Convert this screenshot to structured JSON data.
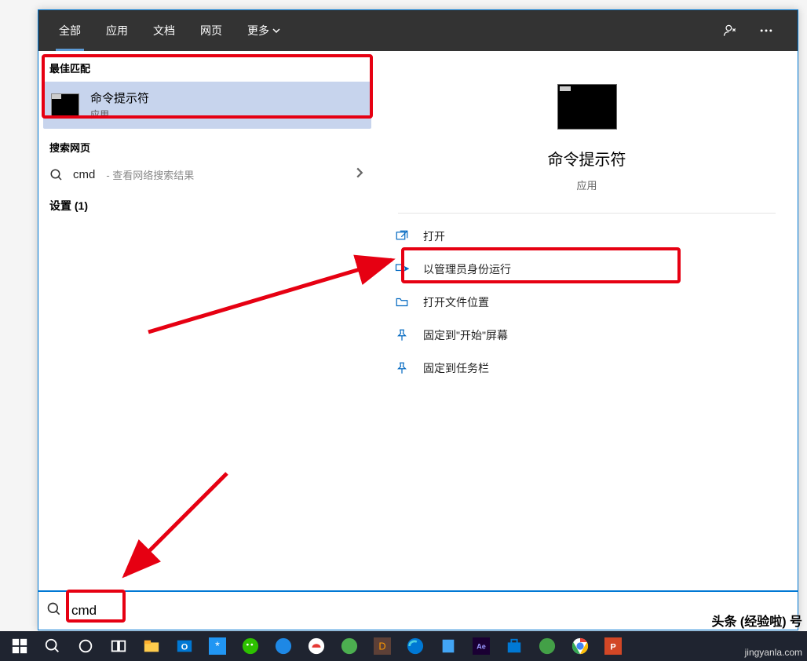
{
  "tabs": {
    "all": "全部",
    "apps": "应用",
    "docs": "文档",
    "web": "网页",
    "more": "更多"
  },
  "left": {
    "best_header": "最佳匹配",
    "best": {
      "title": "命令提示符",
      "subtitle": "应用"
    },
    "web_header": "搜索网页",
    "web_item": {
      "query": "cmd",
      "hint": "- 查看网络搜索结果"
    },
    "settings_header": "设置 (1)"
  },
  "hero": {
    "title": "命令提示符",
    "subtitle": "应用"
  },
  "actions": {
    "open": "打开",
    "run_admin": "以管理员身份运行",
    "open_location": "打开文件位置",
    "pin_start": "固定到\"开始\"屏幕",
    "pin_taskbar": "固定到任务栏"
  },
  "search": {
    "value": "cmd",
    "placeholder": ""
  },
  "watermark": {
    "top": "头条 (经验啦) 号",
    "bottom": "jingyanla.com"
  }
}
